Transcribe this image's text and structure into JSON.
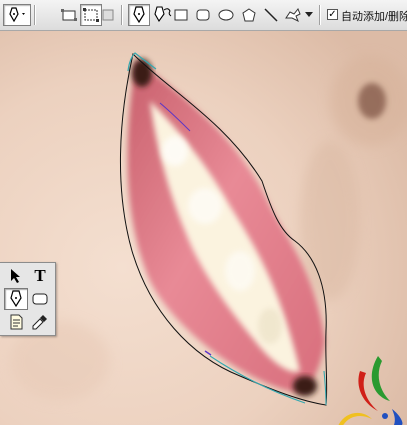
{
  "options_bar": {
    "auto_add_delete_label": "自动添加/删除",
    "auto_add_delete_checked": true,
    "icons": [
      "pen-tool-icon",
      "shape-layers-icon",
      "paths-icon",
      "fill-pixels-icon",
      "pen-icon",
      "freeform-pen-icon",
      "rectangle-icon",
      "rounded-rectangle-icon",
      "ellipse-icon",
      "polygon-icon",
      "line-icon",
      "custom-shape-icon",
      "dropdown-arrow-icon"
    ]
  },
  "tools_panel": {
    "type_tool_label": "T",
    "icons": [
      "path-selection-icon",
      "type-icon",
      "pen-icon",
      "rounded-rectangle-icon",
      "notes-icon",
      "eyedropper-icon"
    ]
  },
  "colors": {
    "skin": "#f0d8c8",
    "lip": "#e07f8c",
    "teeth": "#f3ecd4",
    "path": "#111111",
    "selected_path": "#35a8b0"
  }
}
